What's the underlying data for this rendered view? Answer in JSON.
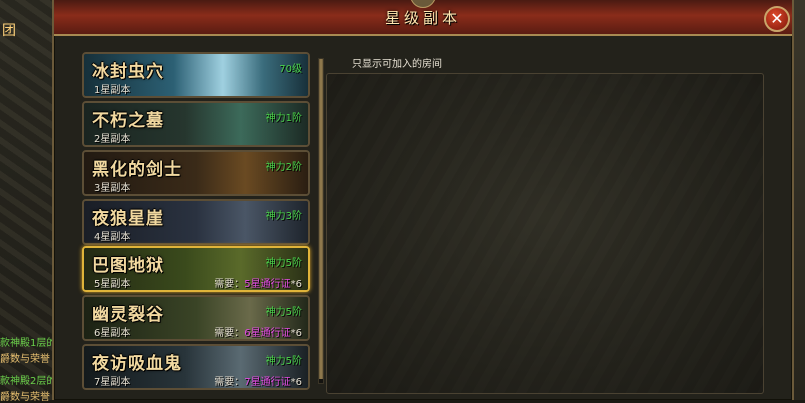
{
  "background": {
    "team_label": "团",
    "chat_lines": [
      {
        "text": "款神殿1层的",
        "color": "#6ad04a"
      },
      {
        "text": "爵数与荣誉",
        "color": "#e8c070"
      },
      {
        "text": "款神殿2层的",
        "color": "#6ad04a"
      },
      {
        "text": "爵数与荣誉",
        "color": "#e8c070"
      }
    ]
  },
  "window": {
    "title": "星级副本",
    "close_icon": "close-icon",
    "close_glyph": "✕"
  },
  "room_filter": {
    "only_joinable_label": "只显示可加入的房间",
    "only_joinable_checked": false
  },
  "dungeons": [
    {
      "name": "冰封虫穴",
      "stars": "1星副本",
      "requirement": "70级",
      "need_label": "",
      "need_pass": "",
      "need_count": "",
      "selected": false,
      "art": "ice"
    },
    {
      "name": "不朽之墓",
      "stars": "2星副本",
      "requirement": "神力1阶",
      "need_label": "",
      "need_pass": "",
      "need_count": "",
      "selected": false,
      "art": "tomb"
    },
    {
      "name": "黑化的剑士",
      "stars": "3星副本",
      "requirement": "神力2阶",
      "need_label": "",
      "need_pass": "",
      "need_count": "",
      "selected": false,
      "art": "dark"
    },
    {
      "name": "夜狼星崖",
      "stars": "4星副本",
      "requirement": "神力3阶",
      "need_label": "",
      "need_pass": "",
      "need_count": "",
      "selected": false,
      "art": "cliff"
    },
    {
      "name": "巴图地狱",
      "stars": "5星副本",
      "requirement": "神力5阶",
      "need_label": "需要：",
      "need_pass": "5星通行证",
      "need_count": "*6",
      "selected": true,
      "art": "hell"
    },
    {
      "name": "幽灵裂谷",
      "stars": "6星副本",
      "requirement": "神力5阶",
      "need_label": "需要：",
      "need_pass": "6星通行证",
      "need_count": "*6",
      "selected": false,
      "art": "rift"
    },
    {
      "name": "夜访吸血鬼",
      "stars": "7星副本",
      "requirement": "神力5阶",
      "need_label": "需要：",
      "need_pass": "7星通行证",
      "need_count": "*6",
      "selected": false,
      "art": "vamp"
    }
  ]
}
